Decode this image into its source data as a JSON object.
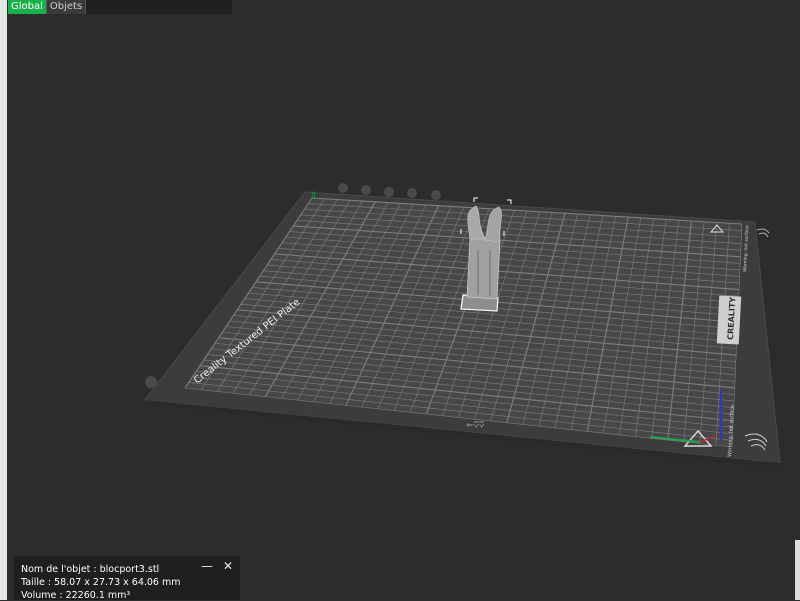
{
  "tabs": [
    {
      "label": "Global",
      "active": true
    },
    {
      "label": "Objets",
      "active": false
    }
  ],
  "plate": {
    "name_label": "Creality Textured PEI Plate",
    "brand_label": "CREALITY",
    "warning_label": "Warning: hot surface"
  },
  "object_info": {
    "name": "Nom de l'objet : blocport3.stl",
    "size": "Taille : 58.07 x 27.73 x 64.06 mm",
    "volume": "Volume : 22260.1 mm³",
    "minimize_icon": "minimize-icon",
    "close_icon": "close-icon"
  },
  "colors": {
    "background": "#2c2c2e",
    "plate": "#3e3e40",
    "grid": "#7b7b7d",
    "model": "#9a9a9a",
    "accent_green": "#17b14a"
  }
}
